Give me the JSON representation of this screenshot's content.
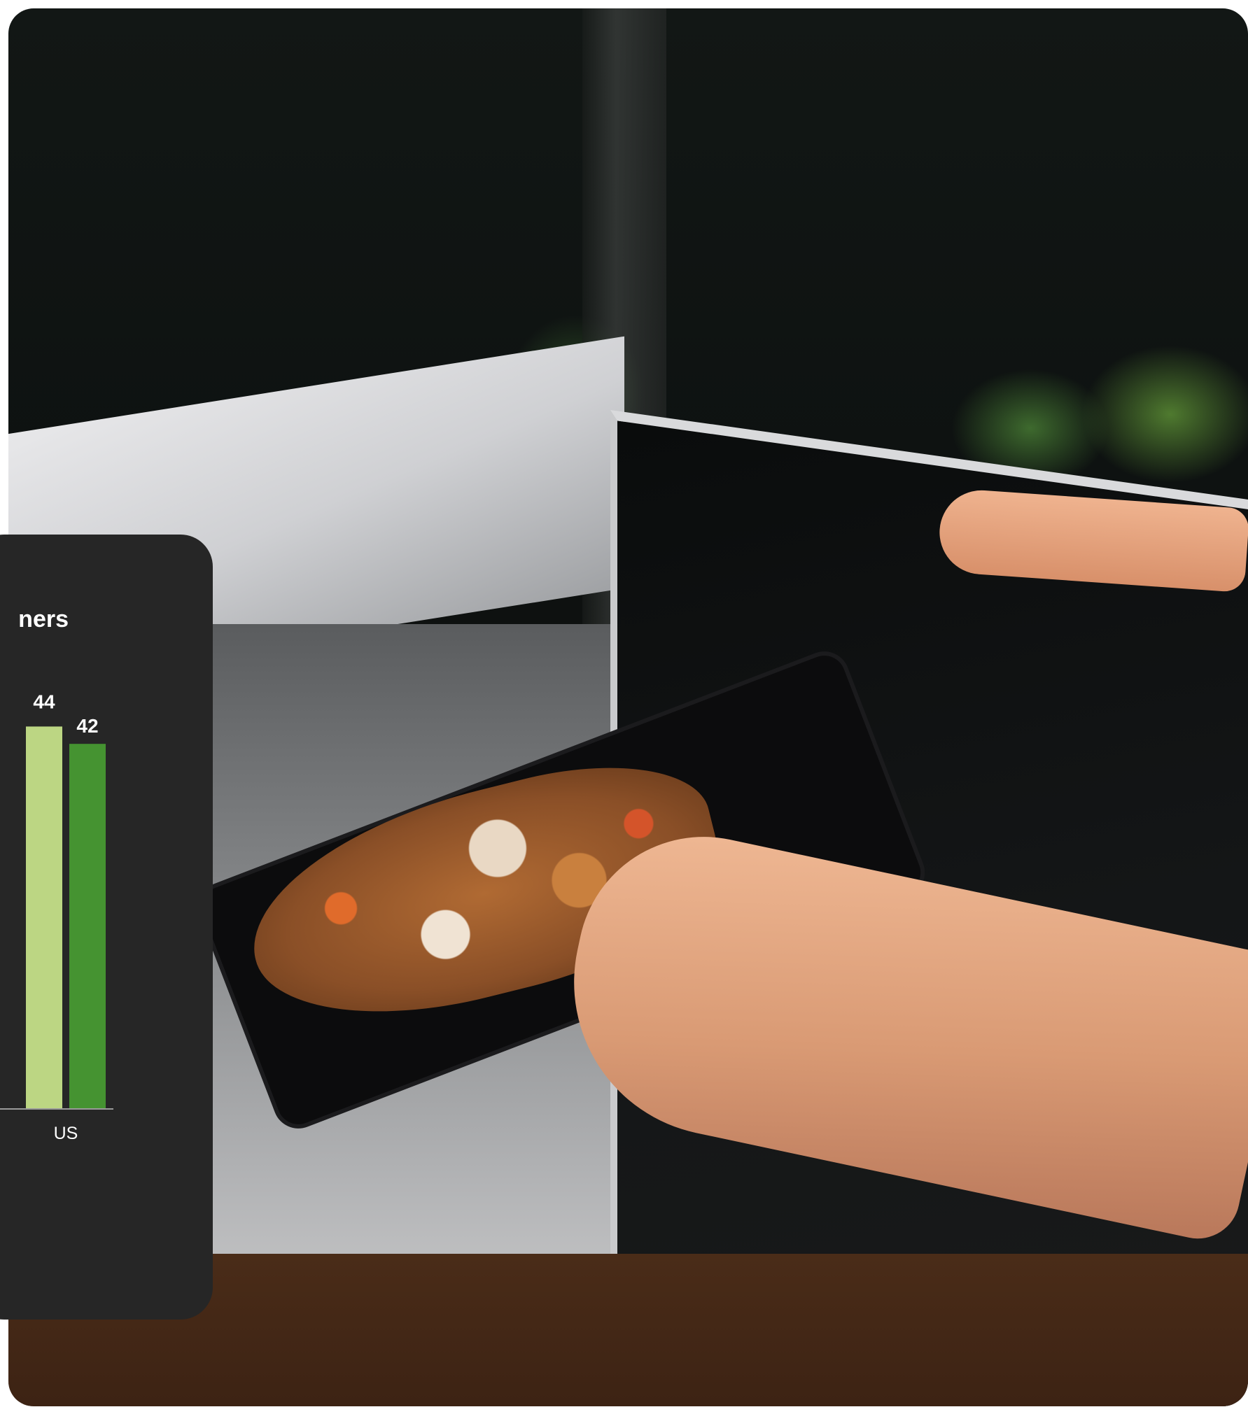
{
  "chart_data": {
    "type": "bar",
    "title": "ners",
    "categories": [
      "US"
    ],
    "series": [
      {
        "values": [
          44
        ],
        "color": "#bcd683"
      },
      {
        "values": [
          42
        ],
        "color": "#459331"
      }
    ],
    "data_labels": [
      [
        "44"
      ],
      [
        "42"
      ]
    ],
    "ylim": [
      0,
      50
    ],
    "grid": false,
    "legend": "none",
    "axis_color": "#9a9a9a",
    "card_color": "#262626"
  }
}
